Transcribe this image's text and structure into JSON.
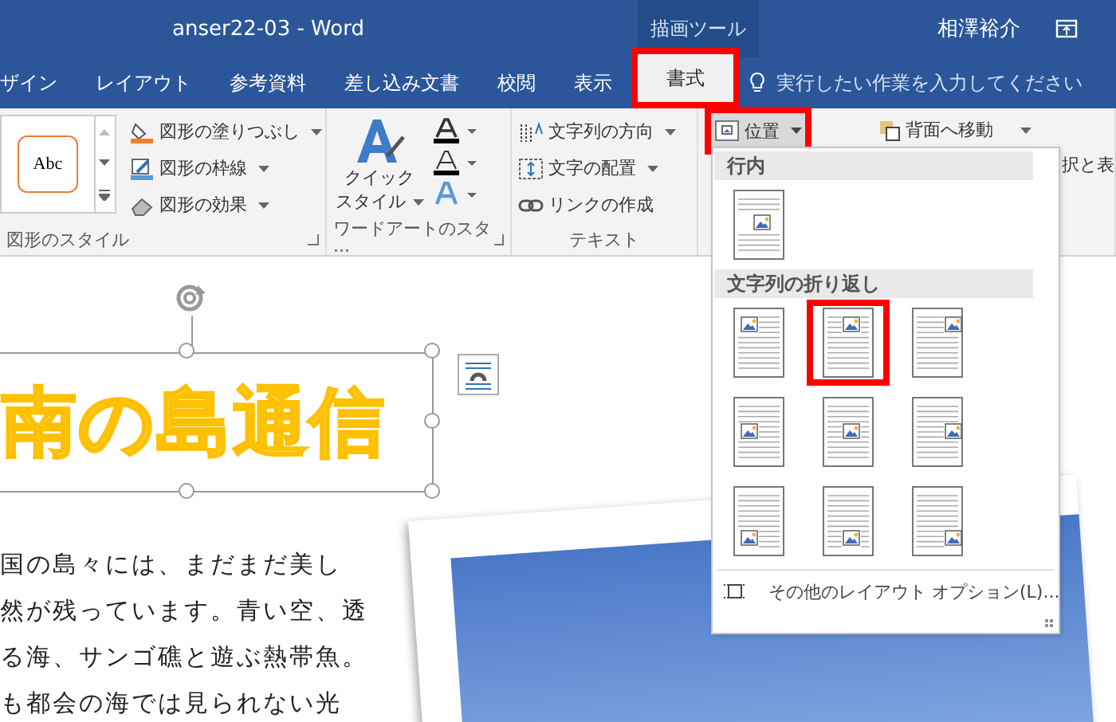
{
  "window": {
    "title": "anser22-03  -  Word",
    "context_label": "描画ツール",
    "user": "相澤裕介"
  },
  "tabs": [
    {
      "label": "ザイン",
      "selected": false,
      "highlighted": false
    },
    {
      "label": "レイアウト",
      "selected": false,
      "highlighted": false
    },
    {
      "label": "参考資料",
      "selected": false,
      "highlighted": false
    },
    {
      "label": "差し込み文書",
      "selected": false,
      "highlighted": false
    },
    {
      "label": "校閲",
      "selected": false,
      "highlighted": false
    },
    {
      "label": "表示",
      "selected": false,
      "highlighted": false
    },
    {
      "label": "書式",
      "selected": true,
      "highlighted": true
    }
  ],
  "tell_me": {
    "placeholder": "実行したい作業を入力してください"
  },
  "ribbon": {
    "shape_styles": {
      "preview": "Abc",
      "commands": [
        "図形の塗りつぶし",
        "図形の枠線",
        "図形の効果"
      ],
      "label": "図形のスタイル"
    },
    "wordart": {
      "quick_style": [
        "クイック",
        "スタイル"
      ],
      "label": "ワードアートのスタ···"
    },
    "text": {
      "commands": [
        "文字列の方向",
        "文字の配置",
        "リンクの作成"
      ],
      "label": "テキスト"
    },
    "arrange": {
      "position": {
        "label": "位置",
        "highlighted": true
      },
      "send_backward": "背面へ移動",
      "selection_pane": "択と表"
    }
  },
  "document": {
    "heading": "南の島通信",
    "paragraph": [
      "国の島々には、まだまだ美し",
      "然が残っています。青い空、透",
      "る海、サンゴ礁と遊ぶ熱帯魚。",
      "も都会の海では見られない光"
    ]
  },
  "position_menu": {
    "sections": [
      {
        "title": "行内",
        "options": [
          {
            "kind": "inline",
            "highlighted": false
          }
        ]
      },
      {
        "title": "文字列の折り返し",
        "options": [
          {
            "kind": "top-left",
            "highlighted": false
          },
          {
            "kind": "top-center",
            "highlighted": true
          },
          {
            "kind": "top-right",
            "highlighted": false
          },
          {
            "kind": "middle-left",
            "highlighted": false
          },
          {
            "kind": "middle-center",
            "highlighted": false
          },
          {
            "kind": "middle-right",
            "highlighted": false
          },
          {
            "kind": "bottom-left",
            "highlighted": false
          },
          {
            "kind": "bottom-center",
            "highlighted": false
          },
          {
            "kind": "bottom-right",
            "highlighted": false
          }
        ]
      }
    ],
    "more_options": "その他のレイアウト オプション(L)..."
  }
}
